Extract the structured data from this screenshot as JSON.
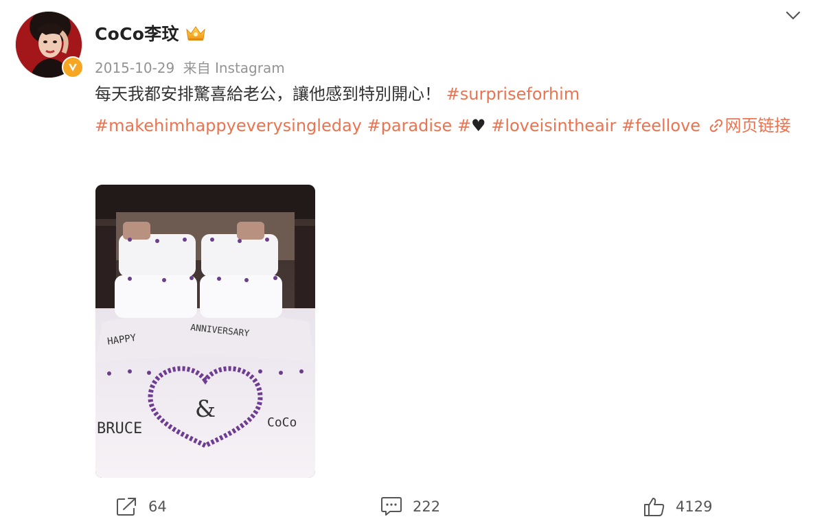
{
  "user": {
    "name": "CoCo李玟",
    "date": "2015-10-29",
    "source": "来自 Instagram"
  },
  "post": {
    "line1_text": "每天我都安排驚喜給老公，讓他感到特別開心！",
    "tags": {
      "surprise": "#surpriseforhim",
      "makehim": "#makehimhappyeverysingleday",
      "paradise": "#paradise",
      "heart_prefix": "#",
      "heart": "♥",
      "loveisintheair": "#loveisintheair",
      "feellove": "#feellove"
    },
    "link_label": "网页链接"
  },
  "photo": {
    "texts": {
      "happy": "HAPPY",
      "anniversary": "ANNIVERSARY",
      "ampersand": "&",
      "left_name": "BRUCE",
      "right_name": "CoCo"
    }
  },
  "actions": {
    "share_count": "64",
    "comment_count": "222",
    "like_count": "4129"
  },
  "colors": {
    "hashtag": "#eb7350",
    "text": "#333333",
    "meta": "#939393",
    "verified": "#f6a623"
  },
  "icons": [
    "chevron-down-icon",
    "crown-icon",
    "verified-icon",
    "link-icon",
    "share-icon",
    "comment-icon",
    "like-icon"
  ]
}
